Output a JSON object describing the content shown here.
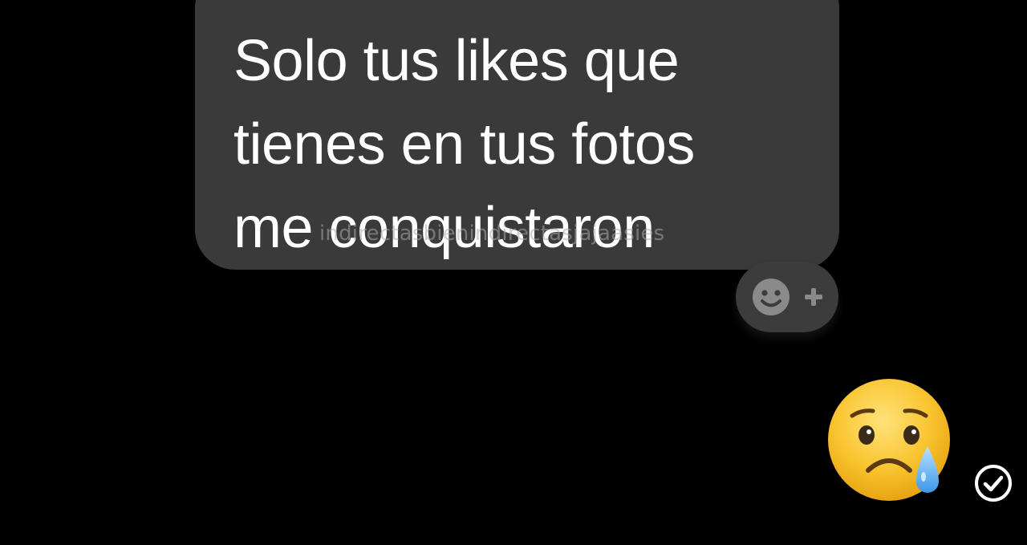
{
  "message": {
    "lines": [
      "Solo tus likes que",
      "tienes en tus fotos",
      "me conquistaron"
    ]
  },
  "watermark": "indirectasbienindirectasjajaasies",
  "reaction_button": {
    "icon": "smiley-plus-icon"
  },
  "sent_message": {
    "emoji": "sad-but-relieved-face-emoji"
  },
  "status": {
    "icon": "sent-check-icon"
  },
  "colors": {
    "background": "#000000",
    "bubble": "#3a3a3a",
    "text": "#ffffff",
    "reaction_button": "#3c3c3c",
    "emoji_face": "#f9c530"
  }
}
